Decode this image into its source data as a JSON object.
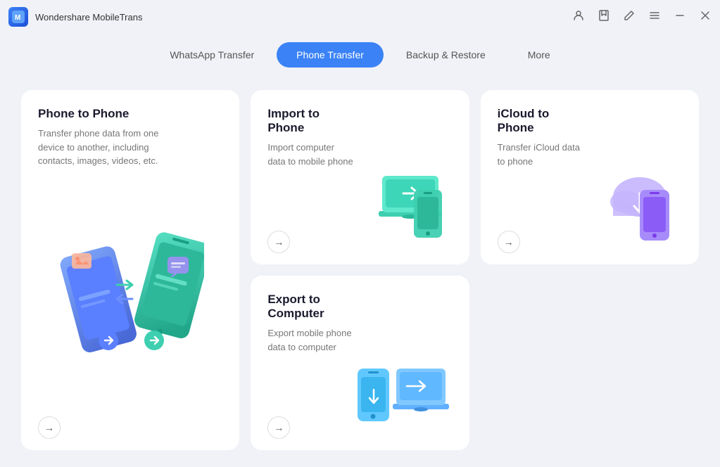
{
  "app": {
    "name": "Wondershare MobileTrans",
    "icon_label": "MT"
  },
  "nav": {
    "tabs": [
      {
        "id": "whatsapp",
        "label": "WhatsApp Transfer",
        "active": false
      },
      {
        "id": "phone",
        "label": "Phone Transfer",
        "active": true
      },
      {
        "id": "backup",
        "label": "Backup & Restore",
        "active": false
      },
      {
        "id": "more",
        "label": "More",
        "active": false
      }
    ]
  },
  "cards": [
    {
      "id": "phone-to-phone",
      "title": "Phone to Phone",
      "description": "Transfer phone data from one device to another, including contacts, images, videos, etc.",
      "large": true
    },
    {
      "id": "import-to-phone",
      "title": "Import to Phone",
      "description": "Import computer data to mobile phone",
      "large": false
    },
    {
      "id": "icloud-to-phone",
      "title": "iCloud to Phone",
      "description": "Transfer iCloud data to phone",
      "large": false
    },
    {
      "id": "export-to-computer",
      "title": "Export to Computer",
      "description": "Export mobile phone data to computer",
      "large": false
    }
  ],
  "titlebar": {
    "account_icon": "👤",
    "bookmark_icon": "🔖",
    "edit_icon": "✏️",
    "menu_icon": "☰",
    "minimize_icon": "—",
    "close_icon": "✕"
  }
}
